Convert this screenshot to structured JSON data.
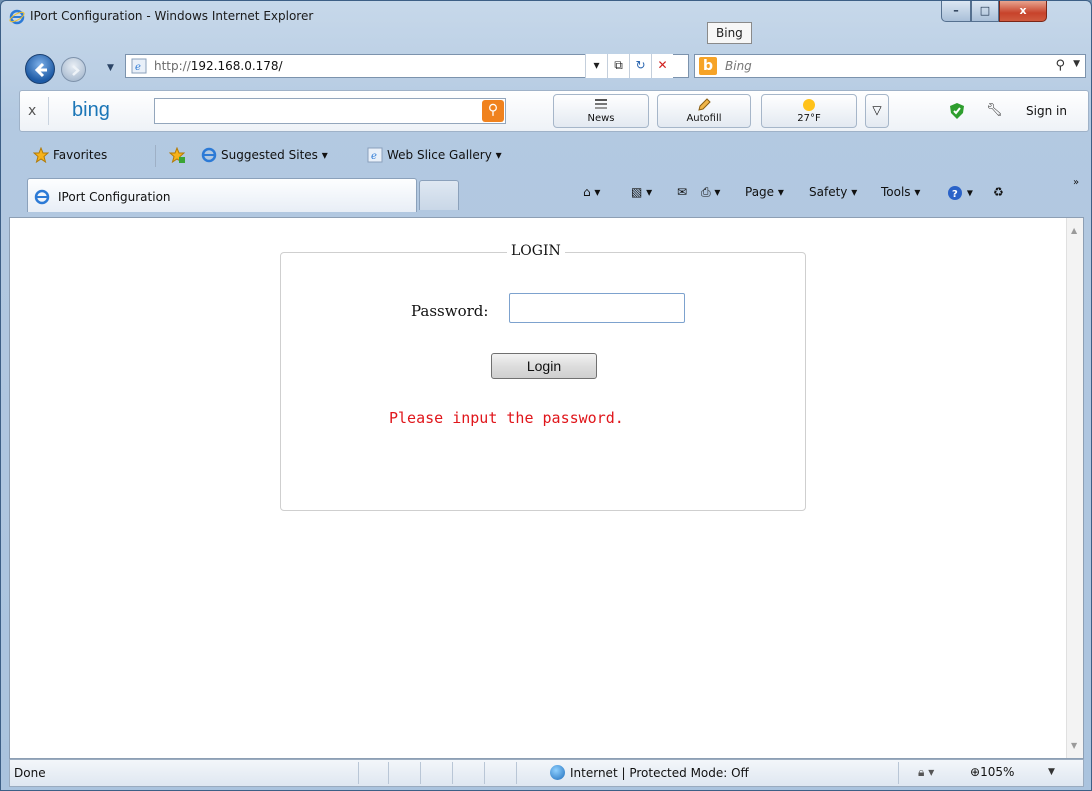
{
  "window": {
    "title": "IPort Configuration - Windows Internet Explorer",
    "tooltip": "Bing",
    "controls": {
      "minimize": "–",
      "maximize": "□",
      "close": "x"
    }
  },
  "address_bar": {
    "url_prefix": "http://",
    "url_host": "192.168.0.178/",
    "search_placeholder": "Bing"
  },
  "bing_bar": {
    "close": "x",
    "logo": "bing",
    "tools": [
      {
        "label": "News",
        "icon": "news-icon"
      },
      {
        "label": "Autofill",
        "icon": "pencil-icon"
      },
      {
        "label": "27°F",
        "icon": "sun-icon"
      }
    ],
    "sign_in": "Sign in"
  },
  "favorites_bar": {
    "favorites": "Favorites",
    "suggested_sites": "Suggested Sites ▾",
    "web_slice_gallery": "Web Slice Gallery ▾"
  },
  "tab": {
    "label": "IPort Configuration"
  },
  "command_bar": {
    "page": "Page",
    "safety": "Safety",
    "tools": "Tools"
  },
  "page": {
    "legend": "LOGIN",
    "password_label": "Password:",
    "password_value": "",
    "login_button": "Login",
    "error_message": "Please input the password."
  },
  "status_bar": {
    "status": "Done",
    "zone": "Internet | Protected Mode: Off",
    "zoom": "105%"
  },
  "colors": {
    "error": "#e0161b",
    "frame": "#b3c9e1",
    "bing_orange": "#f0821e"
  }
}
